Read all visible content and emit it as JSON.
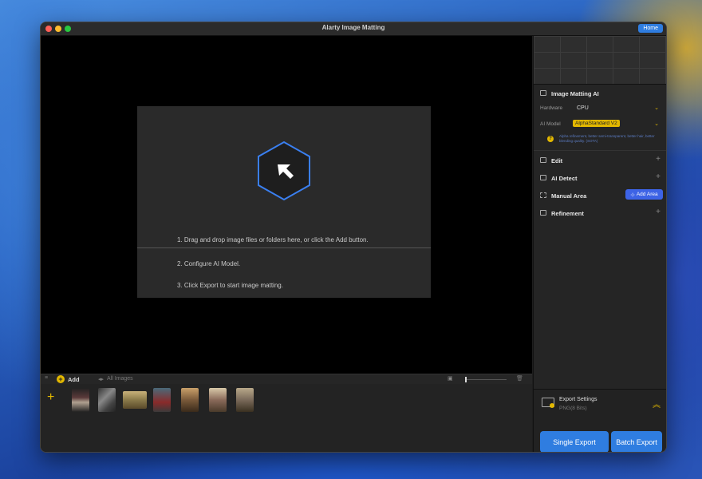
{
  "window": {
    "title": "Alarty Image Matting",
    "home_label": "Home"
  },
  "dropzone": {
    "step1": "1. Drag and drop image files or folders here, or click the Add button.",
    "step2": "2. Configure AI Model.",
    "step3": "3. Click Export to start image matting."
  },
  "bottombar": {
    "add_label": "Add",
    "all_images_label": "All Images"
  },
  "panel": {
    "image_matting_title": "Image Matting AI",
    "hardware_label": "Hardware",
    "hardware_value": "CPU",
    "ai_model_label": "AI Model",
    "ai_model_value": "AlphaStandard  V2",
    "ai_model_desc": "Alpha refinement, better semi-transparent, better hair, better blending quality. (SOTA)",
    "edit_title": "Edit",
    "ai_detect_title": "AI Detect",
    "manual_area_title": "Manual Area",
    "add_area_label": "Add Area",
    "refinement_title": "Refinement"
  },
  "export": {
    "settings_title": "Export Settings",
    "settings_value": "PNG(8 Bits)",
    "single_label": "Single Export",
    "batch_label": "Batch Export"
  },
  "colors": {
    "accent": "#2f7de0",
    "model_tag": "#e3b800",
    "add_area": "#3d63e6"
  }
}
